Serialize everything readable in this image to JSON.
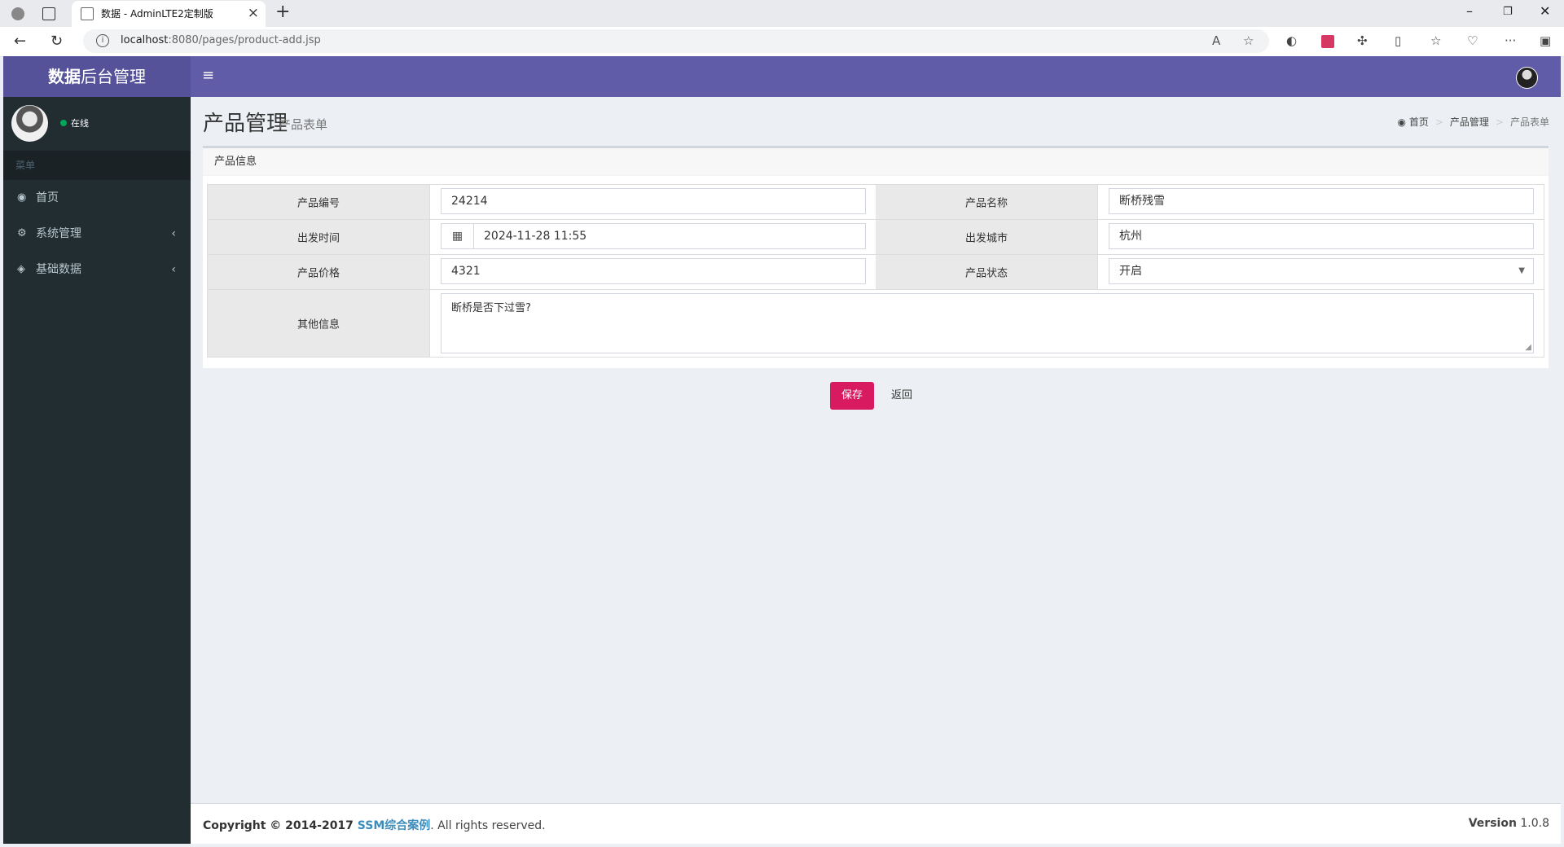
{
  "browser": {
    "tab_title": "数据 - AdminLTE2定制版",
    "url_host": "localhost",
    "url_rest": ":8080/pages/product-add.jsp"
  },
  "header": {
    "logo_bold": "数据",
    "logo_rest": "后台管理",
    "toggle_icon": "≡"
  },
  "sidebar": {
    "status": "在线",
    "menu_header": "菜单",
    "items": [
      {
        "label": "首页",
        "icon": "dashboard-icon",
        "expandable": false
      },
      {
        "label": "系统管理",
        "icon": "cogs-icon",
        "expandable": true
      },
      {
        "label": "基础数据",
        "icon": "cube-icon",
        "expandable": true
      }
    ]
  },
  "page": {
    "title": "产品管理",
    "subtitle": "产品表单",
    "breadcrumb": [
      "首页",
      "产品管理",
      "产品表单"
    ]
  },
  "form": {
    "box_title": "产品信息",
    "product_num_label": "产品编号",
    "product_num_value": "24214",
    "product_name_label": "产品名称",
    "product_name_value": "断桥残雪",
    "depart_time_label": "出发时间",
    "depart_time_value": "2024-11-28 11:55",
    "city_label": "出发城市",
    "city_value": "杭州",
    "price_label": "产品价格",
    "price_value": "4321",
    "status_label": "产品状态",
    "status_value": "开启",
    "desc_label": "其他信息",
    "desc_value": "断桥是否下过雪?",
    "save_label": "保存",
    "back_label": "返回"
  },
  "footer": {
    "copyright_prefix": "Copyright © 2014-2017 ",
    "company": "SSM综合案例",
    "suffix": ". All rights reserved.",
    "version_label": "Version",
    "version": "1.0.8"
  },
  "colors": {
    "header": "#605ca8",
    "logo_bg": "#555299",
    "sidebar": "#222d32",
    "save_button": "#d81b60",
    "link": "#3c8dbc"
  }
}
